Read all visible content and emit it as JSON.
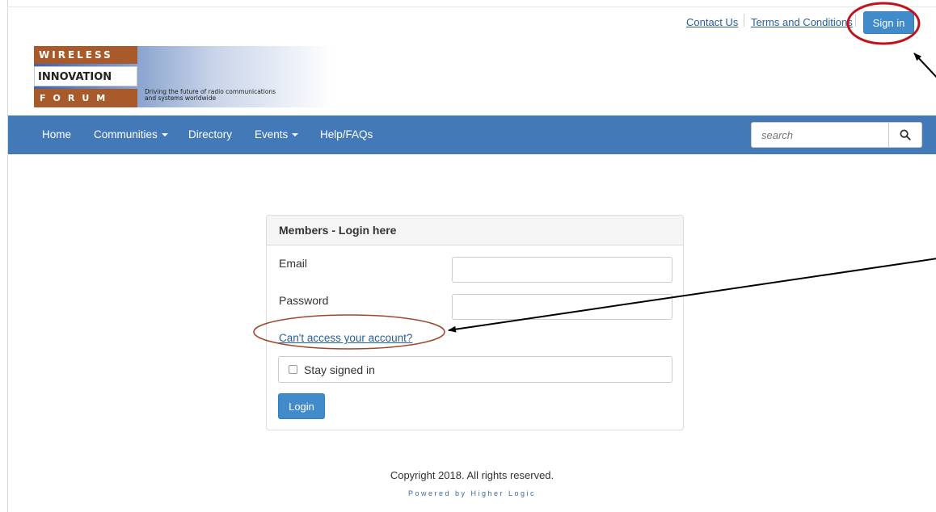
{
  "utility_nav": {
    "contact": "Contact Us",
    "terms": "Terms and Conditions",
    "signin": "Sign in"
  },
  "logo": {
    "line1": "WIRELESS",
    "line2": "INNOVATION",
    "line3": "FORUM",
    "tagline_1": "Driving the future of radio communications",
    "tagline_2": "and systems worldwide"
  },
  "nav": {
    "items": [
      {
        "label": "Home"
      },
      {
        "label": "Communities",
        "dropdown": true
      },
      {
        "label": "Directory"
      },
      {
        "label": "Events",
        "dropdown": true
      },
      {
        "label": "Help/FAQs"
      }
    ],
    "search_placeholder": "search",
    "search_icon": "search-icon"
  },
  "login_panel": {
    "title": "Members - Login here",
    "email_label": "Email",
    "email_value": "",
    "password_label": "Password",
    "password_value": "",
    "forgot_link": "Can't access your account?",
    "stay_signed_in": "Stay signed in",
    "stay_signed_in_checked": false,
    "login_button": "Login"
  },
  "footer": {
    "copyright": "Copyright 2018. All rights reserved.",
    "powered": "Powered by Higher Logic"
  },
  "colors": {
    "nav_bg": "#4479b8",
    "button_blue": "#428bca",
    "link_blue": "#2a5d9c",
    "logo_brown": "#a85a2a",
    "annotation_red": "#c0121b",
    "annotation_ellipse": "#a3452a"
  }
}
